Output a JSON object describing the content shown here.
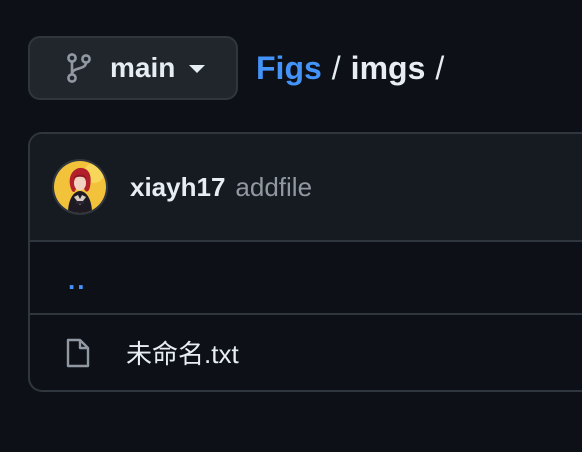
{
  "branch": {
    "name": "main",
    "icon": "git-branch-icon",
    "caret_icon": "triangle-down-icon"
  },
  "breadcrumb": {
    "repo": "Figs",
    "separator": "/",
    "folder": "imgs",
    "trailing_separator": "/"
  },
  "commit": {
    "author": "xiayh17",
    "message": "addfile",
    "avatar_icon": "user-avatar"
  },
  "parent_dir": {
    "label": ".."
  },
  "files": [
    {
      "name": "未命名.txt",
      "icon": "file-icon"
    }
  ],
  "colors": {
    "background": "#0d1117",
    "panel": "#161b22",
    "border": "#30363d",
    "link": "#4493f8",
    "text": "#e6edf3",
    "muted": "#9198a1"
  }
}
